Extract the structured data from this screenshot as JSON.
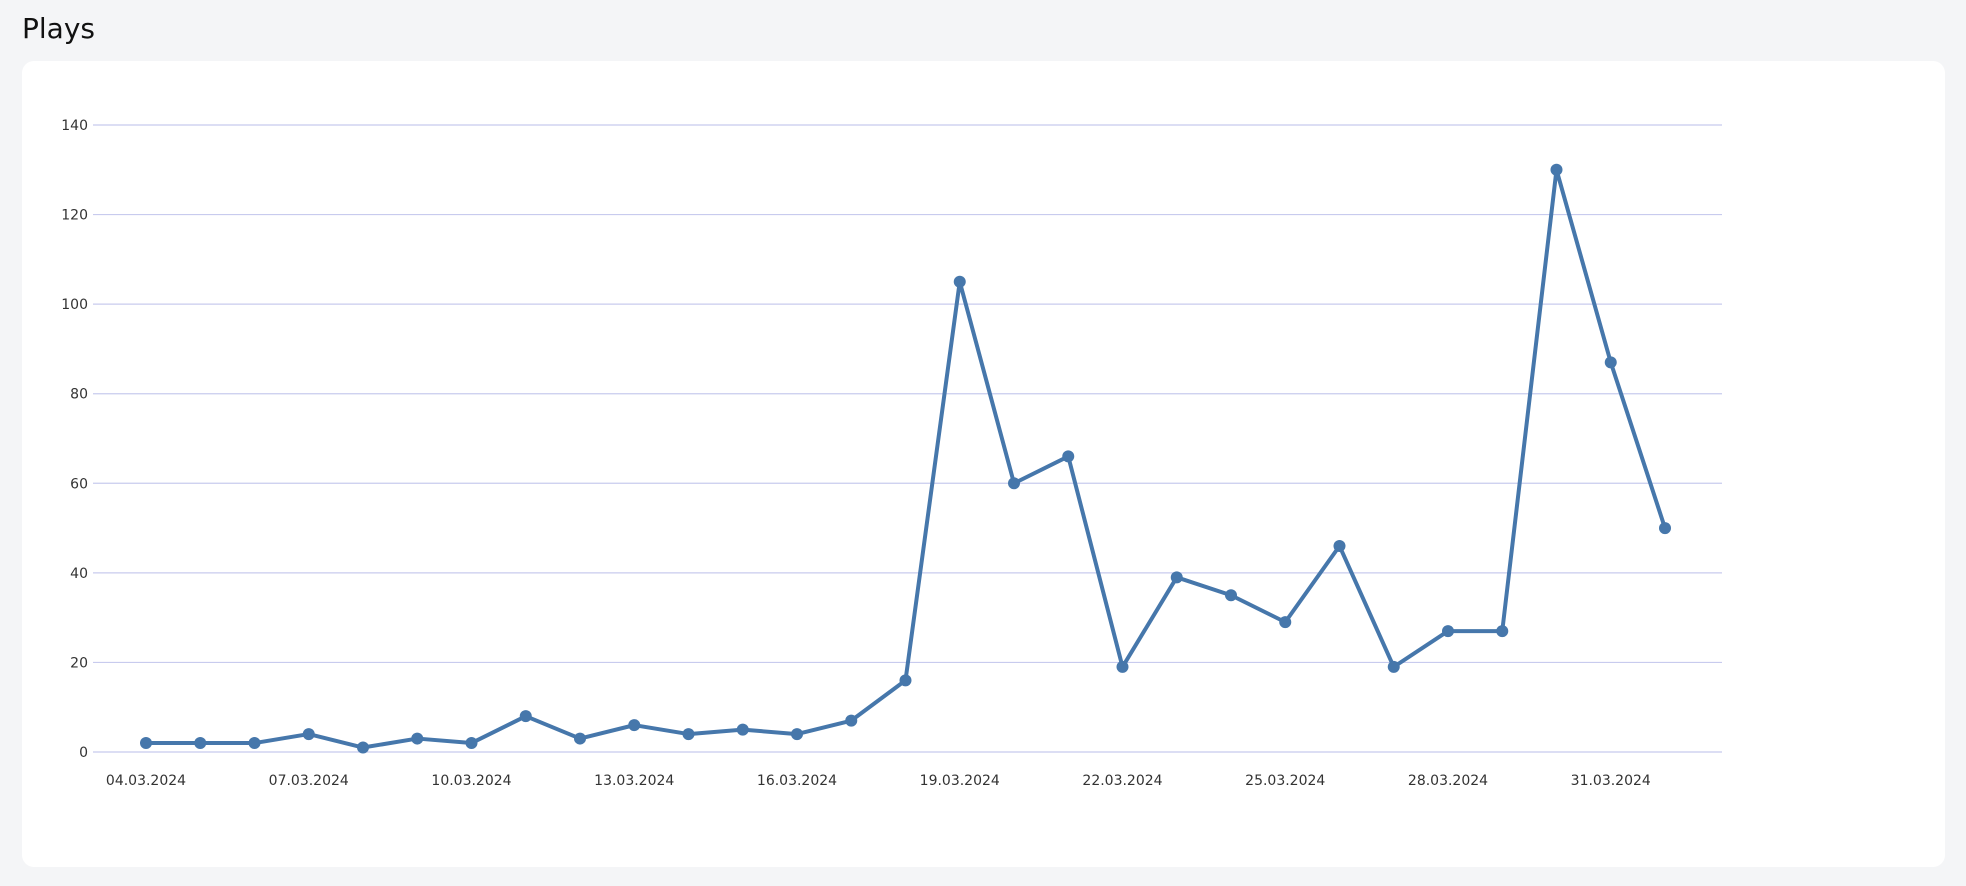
{
  "page": {
    "title": "Plays"
  },
  "colors": {
    "line": "#4677ab",
    "grid": "#c8cbee",
    "card_background": "#ffffff",
    "page_background": "#f4f5f7"
  },
  "chart_data": {
    "type": "line",
    "title": "",
    "xlabel": "",
    "ylabel": "",
    "ylim": [
      0,
      140
    ],
    "yticks": [
      0,
      20,
      40,
      60,
      80,
      100,
      120,
      140
    ],
    "grid": true,
    "legend": "none",
    "x": [
      "04.03.2024",
      "05.03.2024",
      "06.03.2024",
      "07.03.2024",
      "08.03.2024",
      "09.03.2024",
      "10.03.2024",
      "11.03.2024",
      "12.03.2024",
      "13.03.2024",
      "14.03.2024",
      "15.03.2024",
      "16.03.2024",
      "17.03.2024",
      "18.03.2024",
      "19.03.2024",
      "20.03.2024",
      "21.03.2024",
      "22.03.2024",
      "23.03.2024",
      "24.03.2024",
      "25.03.2024",
      "26.03.2024",
      "27.03.2024",
      "28.03.2024",
      "29.03.2024",
      "30.03.2024",
      "31.03.2024",
      "01.04.2024"
    ],
    "xticks_shown": [
      "04.03.2024",
      "07.03.2024",
      "10.03.2024",
      "13.03.2024",
      "16.03.2024",
      "19.03.2024",
      "22.03.2024",
      "25.03.2024",
      "28.03.2024",
      "31.03.2024"
    ],
    "series": [
      {
        "values": [
          2,
          2,
          2,
          4,
          1,
          3,
          2,
          8,
          3,
          6,
          4,
          5,
          4,
          7,
          16,
          105,
          60,
          66,
          19,
          39,
          35,
          29,
          46,
          19,
          27,
          27,
          130,
          87,
          50
        ]
      }
    ]
  }
}
